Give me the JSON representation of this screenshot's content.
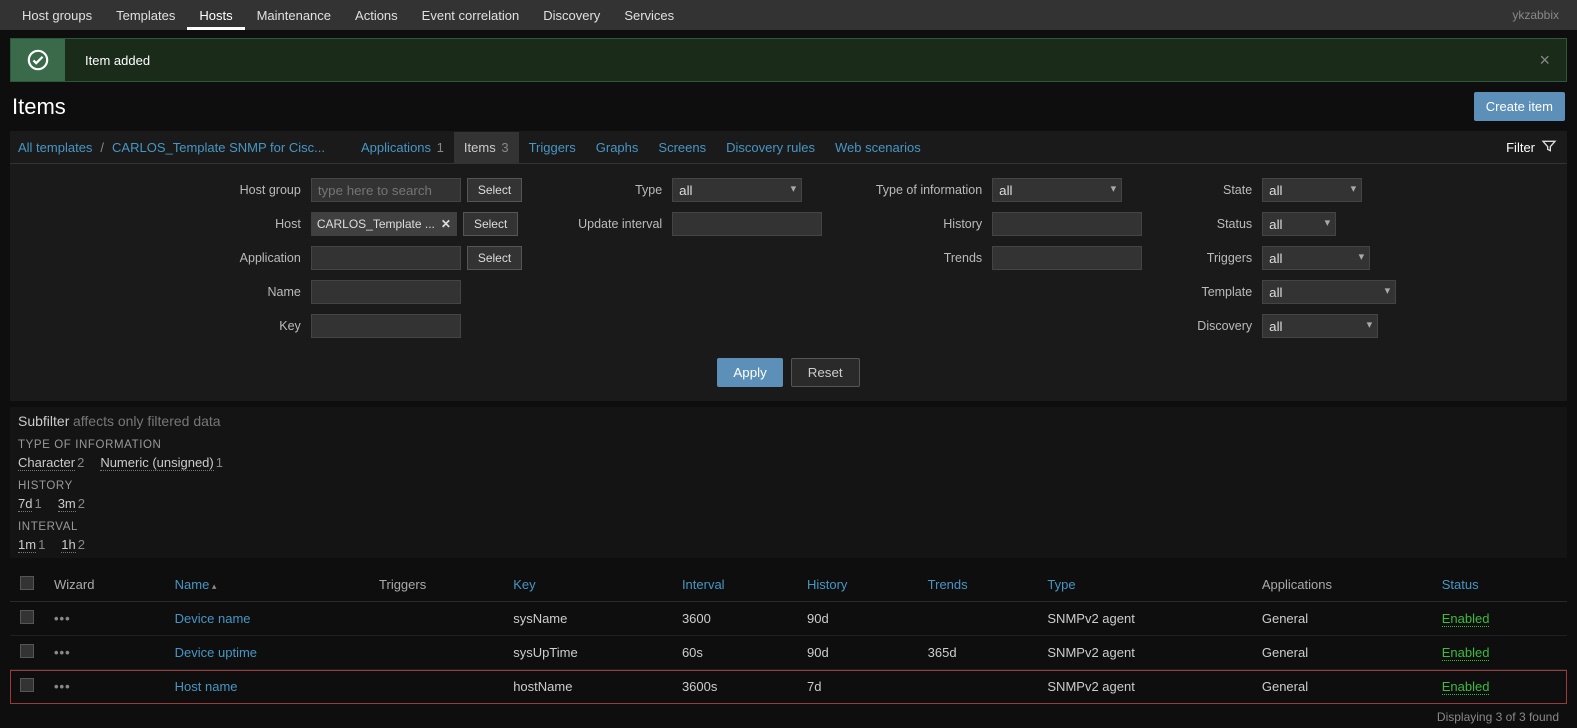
{
  "topnav": {
    "items": [
      "Host groups",
      "Templates",
      "Hosts",
      "Maintenance",
      "Actions",
      "Event correlation",
      "Discovery",
      "Services"
    ],
    "active": "Hosts",
    "user": "ykzabbix"
  },
  "notice": {
    "text": "Item added"
  },
  "page": {
    "title": "Items",
    "create_btn": "Create item"
  },
  "breadcrumb": {
    "all_templates": "All templates",
    "template": "CARLOS_Template SNMP for Cisc..."
  },
  "tabs": {
    "applications": {
      "label": "Applications",
      "count": "1"
    },
    "items": {
      "label": "Items",
      "count": "3"
    },
    "triggers": {
      "label": "Triggers"
    },
    "graphs": {
      "label": "Graphs"
    },
    "screens": {
      "label": "Screens"
    },
    "discovery": {
      "label": "Discovery rules"
    },
    "web": {
      "label": "Web scenarios"
    }
  },
  "filter_toggle": "Filter",
  "filter": {
    "labels": {
      "host_group": "Host group",
      "host": "Host",
      "application": "Application",
      "name": "Name",
      "key": "Key",
      "type": "Type",
      "update_interval": "Update interval",
      "type_of_info": "Type of information",
      "history": "History",
      "trends": "Trends",
      "state": "State",
      "status": "Status",
      "triggers": "Triggers",
      "template": "Template",
      "discovery": "Discovery"
    },
    "placeholder": "type here to search",
    "host_tag": "CARLOS_Template ...",
    "select_btn": "Select",
    "all": "all",
    "apply": "Apply",
    "reset": "Reset"
  },
  "subfilter": {
    "title": "Subfilter",
    "hint": "affects only filtered data",
    "groups": [
      {
        "title": "TYPE OF INFORMATION",
        "items": [
          {
            "label": "Character",
            "count": "2"
          },
          {
            "label": "Numeric (unsigned)",
            "count": "1"
          }
        ]
      },
      {
        "title": "HISTORY",
        "items": [
          {
            "label": "7d",
            "count": "1"
          },
          {
            "label": "3m",
            "count": "2"
          }
        ]
      },
      {
        "title": "INTERVAL",
        "items": [
          {
            "label": "1m",
            "count": "1"
          },
          {
            "label": "1h",
            "count": "2"
          }
        ]
      }
    ]
  },
  "table": {
    "headers": {
      "wizard": "Wizard",
      "name": "Name",
      "triggers": "Triggers",
      "key": "Key",
      "interval": "Interval",
      "history": "History",
      "trends": "Trends",
      "type": "Type",
      "applications": "Applications",
      "status": "Status"
    },
    "rows": [
      {
        "name": "Device name",
        "key": "sysName",
        "interval": "3600",
        "history": "90d",
        "trends": "",
        "type": "SNMPv2 agent",
        "applications": "General",
        "status": "Enabled",
        "highlight": false
      },
      {
        "name": "Device uptime",
        "key": "sysUpTime",
        "interval": "60s",
        "history": "90d",
        "trends": "365d",
        "type": "SNMPv2 agent",
        "applications": "General",
        "status": "Enabled",
        "highlight": false
      },
      {
        "name": "Host name",
        "key": "hostName",
        "interval": "3600s",
        "history": "7d",
        "trends": "",
        "type": "SNMPv2 agent",
        "applications": "General",
        "status": "Enabled",
        "highlight": true
      }
    ],
    "footer": "Displaying 3 of 3 found"
  }
}
